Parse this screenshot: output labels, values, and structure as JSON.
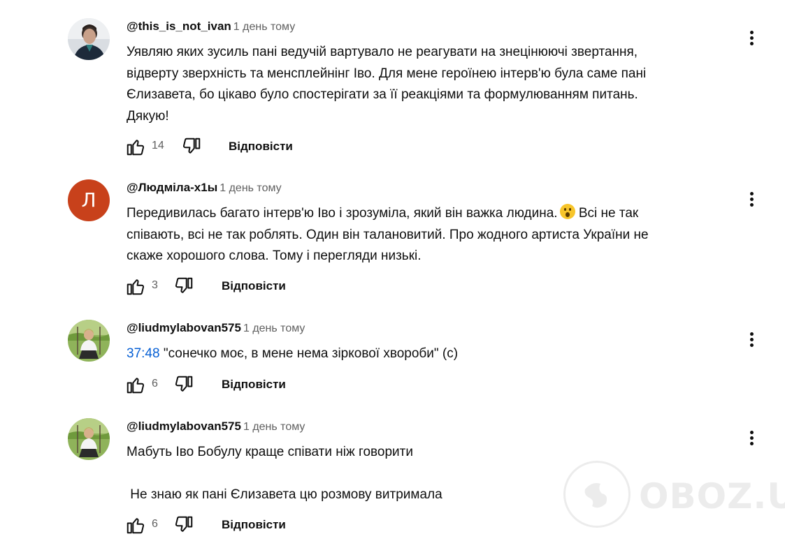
{
  "comments": [
    {
      "author": "@this_is_not_ivan",
      "time": "1 день тому",
      "lines": [
        "Уявляю яких зусиль пані ведучій вартувало не реагувати на знецінюючі звертання,",
        "відверту зверхність та менсплейнінг Іво. Для мене героїнею інтерв'ю була саме пані",
        "Єлизавета, бо цікаво було спостерігати за її реакціями та формулюванням питань.",
        "Дякую!"
      ],
      "likes": "14",
      "reply": "Відповісти",
      "avatar": "photo-avatar-man"
    },
    {
      "author": "@Людміла-х1ы",
      "time": "1 день тому",
      "avatar_letter": "Л",
      "avatar_color": "#c8411b",
      "lines": [
        "Передивилась багато інтерв'ю Іво і зрозуміла,  який він важка людина.",
        "співають, всі не так роблять. Один він талановитий. Про жодного артиста України не",
        "скаже хорошого слова. Тому і перегляди низькі."
      ],
      "line1_after_emoji": " Всі не так",
      "emoji": "astonished-face-emoji",
      "likes": "3",
      "reply": "Відповісти"
    },
    {
      "author": "@liudmylabovan575",
      "time": "1 день тому",
      "timestamp": "37:48",
      "text": " \"сонечко моє, в мене нема зіркової хвороби\" (с)",
      "likes": "6",
      "reply": "Відповісти",
      "avatar": "photo-avatar-woman-field"
    },
    {
      "author": "@liudmylabovan575",
      "time": "1 день тому",
      "lines": [
        "Мабуть Іво Бобулу краще співати ніж говорити",
        " Не знаю як пані Єлизавета цю розмову витримала"
      ],
      "likes": "6",
      "reply": "Відповісти",
      "avatar": "photo-avatar-woman-field"
    }
  ],
  "watermark": "OBOZ.UA",
  "colors": {
    "timestamp_link": "#065fd4",
    "secondary_text": "#606060"
  }
}
